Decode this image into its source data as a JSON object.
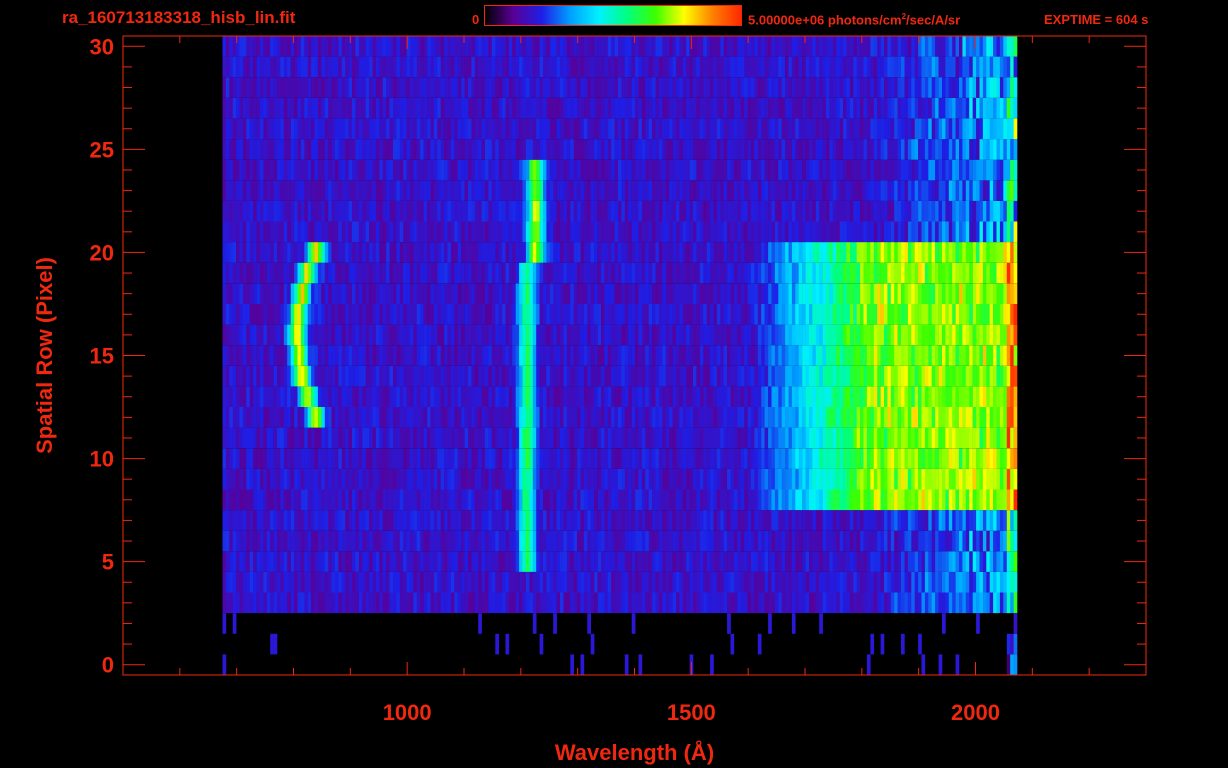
{
  "header": {
    "filename": "ra_160713183318_hisb_lin.fit",
    "colorbar_min": "0",
    "colorbar_max_prefix": "5.00000e+06 photons/cm",
    "colorbar_max_sup": "2",
    "colorbar_max_suffix": "/sec/A/sr",
    "exptime": "EXPTIME = 604 s"
  },
  "colors": {
    "axis": "#f0280f",
    "background": "#000000",
    "colormap": [
      "#000000",
      "#5a0096",
      "#1e1ee6",
      "#00a0ff",
      "#00f0ff",
      "#00ff80",
      "#3cff00",
      "#ffff00",
      "#ff8000",
      "#ff2800"
    ]
  },
  "chart_data": {
    "type": "heatmap",
    "title": "",
    "xlabel": "Wavelength (Å)",
    "ylabel": "Spatial Row (Pixel)",
    "xlim": [
      500,
      2300
    ],
    "ylim": [
      -0.5,
      30.5
    ],
    "x_ticks": [
      1000,
      1500,
      2000
    ],
    "y_ticks": [
      0,
      5,
      10,
      15,
      20,
      25,
      30
    ],
    "colorbar_range": [
      0,
      5000000
    ],
    "colorbar_units": "photons/cm^2/sec/A/sr",
    "data_extent": {
      "x": [
        675,
        2070
      ],
      "rows": [
        0,
        30
      ]
    },
    "features": [
      {
        "name": "",
        "wavelength_A": 834,
        "rows": [
          12,
          20
        ],
        "peak_fraction": 0.6
      },
      {
        "name": "",
        "wavelength_A": 1216,
        "rows": [
          5,
          24
        ],
        "peak_fraction": 0.5
      },
      {
        "name": "",
        "wavelength_A": [
          1700,
          2060
        ],
        "rows": [
          8,
          20
        ],
        "peak_fraction": 0.6
      }
    ]
  }
}
